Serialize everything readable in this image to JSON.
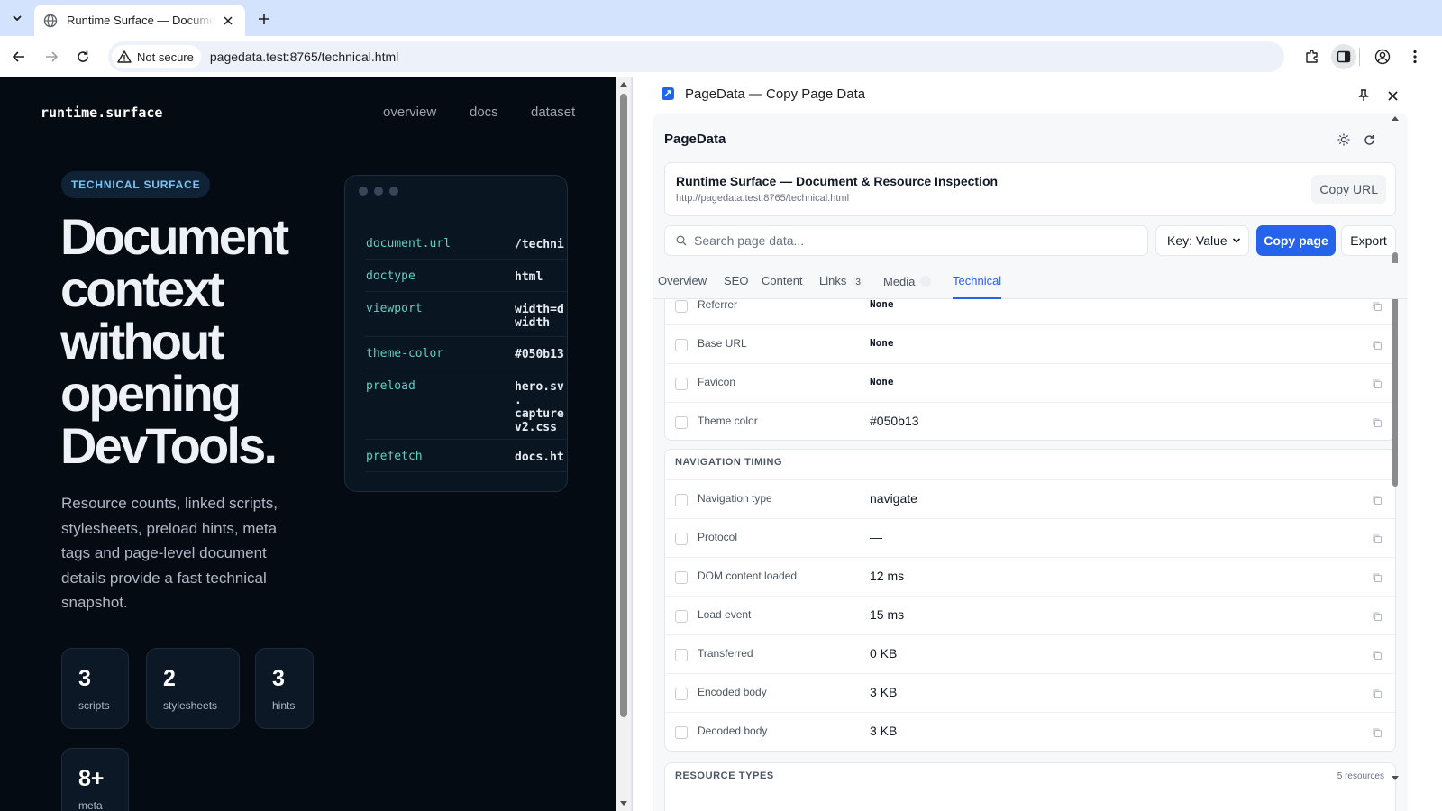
{
  "browser": {
    "tab_title": "Runtime Surface — Document & Resource Inspection",
    "security_label": "Not secure",
    "url": "pagedata.test:8765/technical.html"
  },
  "site": {
    "logo": "runtime.surface",
    "nav": [
      "overview",
      "docs",
      "dataset"
    ],
    "badge": "TECHNICAL SURFACE",
    "hero_title": "Document context without opening DevTools.",
    "description": "Resource counts, linked scripts, stylesheets, preload hints, meta tags and page-level document details provide a fast technical snapshot.",
    "stats": [
      {
        "value": "3",
        "label": "scripts"
      },
      {
        "value": "2",
        "label": "stylesheets"
      },
      {
        "value": "3",
        "label": "hints"
      },
      {
        "value": "8+",
        "label": "meta"
      }
    ],
    "code_rows": [
      {
        "key": "document.url",
        "value": "/techni"
      },
      {
        "key": "doctype",
        "value": "html"
      },
      {
        "key": "viewport",
        "value": "width=d\nwidth"
      },
      {
        "key": "theme-color",
        "value": "#050b13"
      },
      {
        "key": "preload",
        "value": "hero.sv\n.\ncapture\nv2.css"
      },
      {
        "key": "prefetch",
        "value": "docs.ht"
      }
    ]
  },
  "panel": {
    "header_title": "PageData — Copy Page Data",
    "app_title": "PageData",
    "page_title": "Runtime Surface — Document & Resource Inspection",
    "page_url": "http://pagedata.test:8765/technical.html",
    "copy_url_label": "Copy URL",
    "search_placeholder": "Search page data...",
    "format_select": "Key: Value",
    "copy_page_label": "Copy page",
    "export_label": "Export",
    "tabs": [
      {
        "label": "Overview"
      },
      {
        "label": "SEO"
      },
      {
        "label": "Content"
      },
      {
        "label": "Links",
        "count": "3"
      },
      {
        "label": "Media"
      },
      {
        "label": "Technical",
        "active": true
      }
    ],
    "document_rows": [
      {
        "key": "Referrer",
        "value": "None"
      },
      {
        "key": "Base URL",
        "value": "None"
      },
      {
        "key": "Favicon",
        "value": "None"
      },
      {
        "key": "Theme color",
        "value": "#050b13"
      }
    ],
    "navigation_timing": {
      "title": "NAVIGATION TIMING",
      "rows": [
        {
          "key": "Navigation type",
          "value": "navigate"
        },
        {
          "key": "Protocol",
          "value": "—"
        },
        {
          "key": "DOM content loaded",
          "value": "12 ms"
        },
        {
          "key": "Load event",
          "value": "15 ms"
        },
        {
          "key": "Transferred",
          "value": "0 KB"
        },
        {
          "key": "Encoded body",
          "value": "3 KB"
        },
        {
          "key": "Decoded body",
          "value": "3 KB"
        }
      ]
    },
    "resource_types": {
      "title": "RESOURCE TYPES",
      "meta": "5 resources"
    }
  },
  "colors": {
    "accent": "#2563eb",
    "page_bg": "#050b13",
    "code_key": "#5fd0c2"
  }
}
